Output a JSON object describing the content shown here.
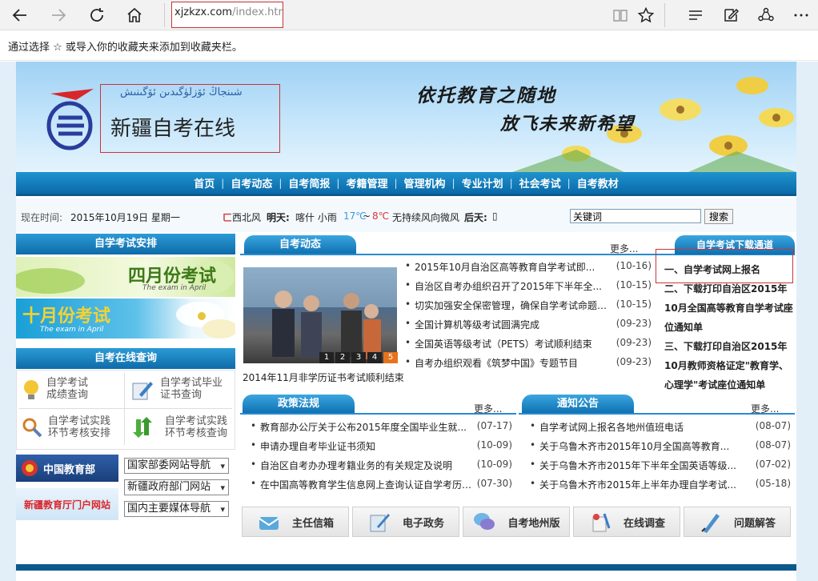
{
  "browser": {
    "address_host": "xjzkzx.com",
    "address_path": "/index.htm",
    "favorites_hint": "通过选择 ☆ 或导入你的收藏夹来添加到收藏夹栏。"
  },
  "site": {
    "name": "新疆自考在线",
    "uyghur_name": "شىنجاڭ ئۆزلۈگىدىن ئۆگىنىش",
    "slogan_line1": "依托教育之随地",
    "slogan_line2": "放飞未来新希望"
  },
  "nav": [
    "首页",
    "自考动态",
    "自考简报",
    "考籍管理",
    "管理机构",
    "专业计划",
    "社会考试",
    "自考教材"
  ],
  "info": {
    "time_label": "现在时间:",
    "date": "2015年10月19日 星期一",
    "weather_prefix": "西北风",
    "tomorrow_label": "明天:",
    "tomorrow_weather": "喀什 小雨",
    "temp_low": "17℃",
    "temp_sep": "~",
    "temp_high": "8℃",
    "wind": "无持续风向微风",
    "day_after_label": "后天:",
    "search_placeholder": "关键词",
    "search_button": "搜索"
  },
  "left": {
    "exam_schedule_title": "自学考试安排",
    "april_title": "四月份考试",
    "april_sub": "The exam in April",
    "october_title": "十月份考试",
    "october_sub": "The exam in April",
    "query_title": "自考在线查询",
    "queries": [
      {
        "line1": "自学考试",
        "line2": "成绩查询"
      },
      {
        "line1": "自学考试毕业",
        "line2": "证书查询"
      },
      {
        "line1": "自学考试实践",
        "line2": "环节考核安排"
      },
      {
        "line1": "自学考试实践",
        "line2": "环节考核查询"
      }
    ],
    "moe_logo": "中国教育部",
    "xj_edu_logo": "新疆教育厅门户网站",
    "nav_selects": [
      "国家部委网站导航",
      "新疆政府部门网站",
      "国内主要媒体导航"
    ]
  },
  "news": {
    "tab": "自考动态",
    "more": "更多...",
    "photo_caption": "2014年11月非学历证书考试顺利结束",
    "photo_pages": [
      "1",
      "2",
      "3",
      "4",
      "5"
    ],
    "items": [
      {
        "title": "2015年10月自治区高等教育自学考试即...",
        "date": "(10-16)"
      },
      {
        "title": "自治区自考办组织召开了2015年下半年全...",
        "date": "(10-15)"
      },
      {
        "title": "切实加强安全保密管理，确保自学考试命题工...",
        "date": "(10-15)"
      },
      {
        "title": "全国计算机等级考试圆满完成",
        "date": "(09-23)"
      },
      {
        "title": "全国英语等级考试（PETS）考试顺利结束",
        "date": "(09-23)"
      },
      {
        "title": "自考办组织观看《筑梦中国》专题节目",
        "date": "(09-23)"
      }
    ]
  },
  "downloads": {
    "tab": "自学考试下载通道",
    "items": [
      "一、自学考试网上报名",
      "二、下载打印自治区2015年10月全国高等教育自学考试座位通知单",
      "三、下载打印自治区2015年10月教师资格证定\"教育学、心理学\"考试座位通知单"
    ]
  },
  "policy": {
    "tab": "政策法规",
    "more": "更多...",
    "items": [
      {
        "title": "教育部办公厅关于公布2015年度全国毕业生就...",
        "date": "(07-17)"
      },
      {
        "title": "申请办理自考毕业证书须知",
        "date": "(10-09)"
      },
      {
        "title": "自治区自考办办理考籍业务的有关规定及说明",
        "date": "(10-09)"
      },
      {
        "title": "在中国高等教育学生信息网上查询认证自学考历的...",
        "date": "(07-30)"
      }
    ]
  },
  "notice": {
    "tab": "通知公告",
    "more": "更多...",
    "items": [
      {
        "title": "自学考试网上报名各地州值班电话",
        "date": "(08-07)"
      },
      {
        "title": "关于乌鲁木齐市2015年10月全国高等教育...",
        "date": "(08-07)"
      },
      {
        "title": "关于乌鲁木齐市2015年下半年全国英语等级...",
        "date": "(07-02)"
      },
      {
        "title": "关于乌鲁木齐市2015年上半年办理自学考试...",
        "date": "(05-18)"
      }
    ]
  },
  "bottom_buttons": [
    "主任信箱",
    "电子政务",
    "自考地州版",
    "在线调查",
    "问题解答"
  ],
  "colors": {
    "nav_blue": "#0e6ba8",
    "accent_red": "#c8353a",
    "temp_low": "#3a9ad9",
    "temp_high": "#d9363a"
  }
}
